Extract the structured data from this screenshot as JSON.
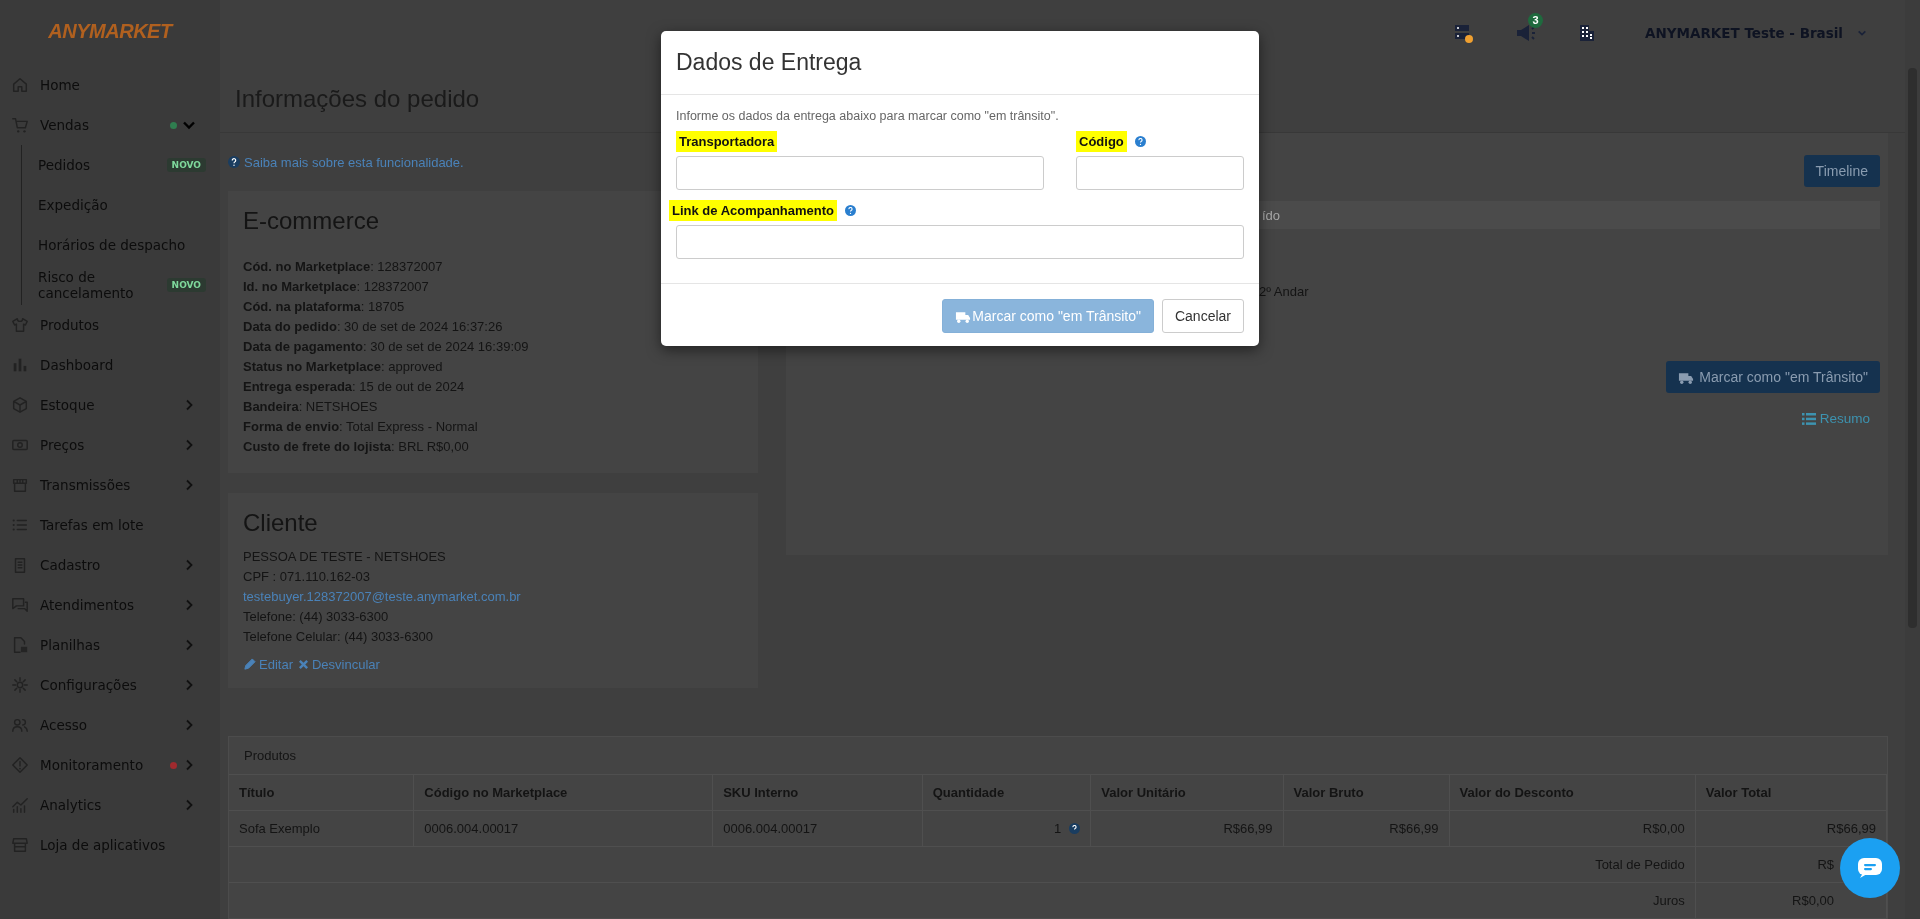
{
  "logo": "ANYMARKET",
  "sidebar": {
    "items": [
      {
        "label": "Home",
        "kind": "link"
      },
      {
        "label": "Vendas",
        "kind": "group",
        "expanded": true,
        "color": "#2f7d4f",
        "children": [
          {
            "label": "Pedidos",
            "badge": "NOVO"
          },
          {
            "label": "Expedição"
          },
          {
            "label": "Horários de despacho"
          },
          {
            "label": "Risco de cancelamento",
            "badge": "NOVO"
          }
        ]
      },
      {
        "label": "Produtos",
        "kind": "link"
      },
      {
        "label": "Dashboard",
        "kind": "link"
      },
      {
        "label": "Estoque",
        "kind": "group",
        "expanded": false
      },
      {
        "label": "Preços",
        "kind": "group",
        "expanded": false
      },
      {
        "label": "Transmissões",
        "kind": "group",
        "expanded": false
      },
      {
        "label": "Tarefas em lote",
        "kind": "link"
      },
      {
        "label": "Cadastro",
        "kind": "group",
        "expanded": false
      },
      {
        "label": "Atendimentos",
        "kind": "group",
        "expanded": false
      },
      {
        "label": "Planilhas",
        "kind": "group",
        "expanded": false
      },
      {
        "label": "Configurações",
        "kind": "group",
        "expanded": false
      },
      {
        "label": "Acesso",
        "kind": "group",
        "expanded": false
      },
      {
        "label": "Monitoramento",
        "kind": "group",
        "expanded": false,
        "color": "#a02a2e"
      },
      {
        "label": "Analytics",
        "kind": "group",
        "expanded": false
      },
      {
        "label": "Loja de aplicativos",
        "kind": "link"
      }
    ]
  },
  "topbar": {
    "notification_count": "3",
    "account": "ANYMARKET Teste - Brasil"
  },
  "page": {
    "title": "Informações do pedido",
    "help_link": "Saiba mais sobre esta funcionalidade."
  },
  "ecommerce": {
    "title": "E-commerce",
    "fields": [
      "**Cód. no Marketplace**: 128372007",
      "**Id. no Marketplace**: 128372007",
      "**Cód. na plataforma**: 18705",
      "**Data do pedido**: 30 de set de 2024 16:37:26",
      "**Data de pagamento**: 30 de set de 2024 16:39:09",
      "**Status no Marketplace**: approved",
      "**Entrega esperada**: 15 de out de 2024",
      "**Bandeira**: NETSHOES",
      "**Forma de envio**: Total Express - Normal",
      "**Custo de frete do lojista**: BRL R$0,00"
    ]
  },
  "client": {
    "title": "Cliente",
    "lines": [
      {
        "text": "PESSOA DE TESTE - NETSHOES",
        "kind": "text"
      },
      {
        "text": "CPF : 071.110.162-03",
        "kind": "text"
      },
      {
        "text": "testebuyer.128372007@teste.anymarket.com.br",
        "kind": "link"
      },
      {
        "text": "Telefone: (44) 3033-6300",
        "kind": "text"
      },
      {
        "text": "Telefone Celular: (44) 3033-6300",
        "kind": "text"
      }
    ],
    "actions": [
      {
        "label": "Editar",
        "kind": "edit"
      },
      {
        "label": "Desvincular",
        "kind": "unlink"
      }
    ]
  },
  "shipping_panel": {
    "timeline_button": "Timeline",
    "status_fragment": "ído",
    "address_fragment": "2º Andar",
    "mark_button": "Marcar como \"em Trânsito\"",
    "summary_link": "Resumo"
  },
  "products": {
    "title": "Produtos",
    "columns": [
      "Título",
      "Código no Marketplace",
      "SKU Interno",
      "Quantidade",
      "Valor Unitário",
      "Valor Bruto",
      "Valor do Desconto",
      "Valor Total"
    ],
    "rows": [
      {
        "cells": [
          "Sofa Exemplo",
          "0006.004.00017",
          "0006.004.00017",
          "1",
          "R$66,99",
          "R$66,99",
          "R$0,00",
          "R$66,99"
        ]
      }
    ],
    "totals": [
      {
        "label": "Total de Pedido",
        "value": "R$"
      },
      {
        "label": "Juros",
        "value": "R$0,00"
      }
    ]
  },
  "modal": {
    "title": "Dados de Entrega",
    "intro": "Informe os dados da entrega abaixo para marcar como \"em trânsito\".",
    "fields": [
      {
        "label": "Transportadora",
        "highlighted": true,
        "help": false
      },
      {
        "label": "Código",
        "highlighted": true,
        "help": true
      },
      {
        "label": "Link de Acompanhamento",
        "highlighted": true,
        "help": true
      }
    ],
    "buttons": [
      {
        "label": "Marcar como \"em Trânsito\"",
        "kind": "primary",
        "disabled": true
      },
      {
        "label": "Cancelar",
        "kind": "default",
        "disabled": false
      }
    ]
  }
}
